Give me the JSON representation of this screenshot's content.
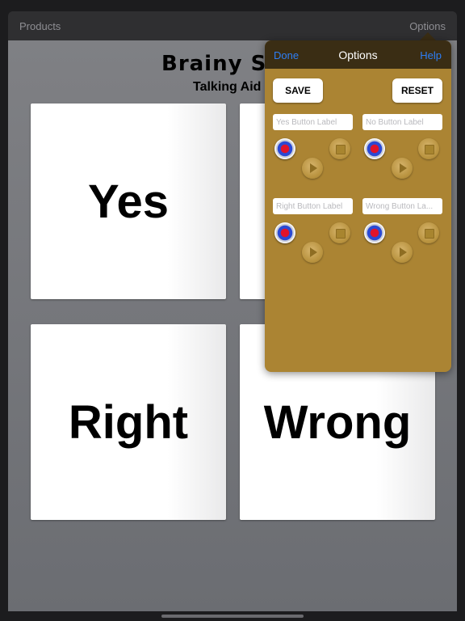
{
  "topbar": {
    "products": "Products",
    "options": "Options"
  },
  "brand": {
    "title": "Brainy Sk",
    "subtitle": "Talking Aid"
  },
  "cards": {
    "yes": "Yes",
    "right": "Right",
    "wrong": "Wrong"
  },
  "popover": {
    "done": "Done",
    "title": "Options",
    "help": "Help",
    "save": "SAVE",
    "reset": "RESET",
    "placeholders": {
      "yes": "Yes Button Label",
      "no": "No Button Label",
      "right": "Right Button Label",
      "wrong": "Wrong Button La..."
    }
  },
  "icons": {
    "record": "record-icon",
    "stop": "stop-icon",
    "play": "play-icon"
  },
  "colors": {
    "popover_bg": "#ab8433",
    "popover_header": "#3a2d14",
    "link_blue": "#2d7ef6"
  }
}
